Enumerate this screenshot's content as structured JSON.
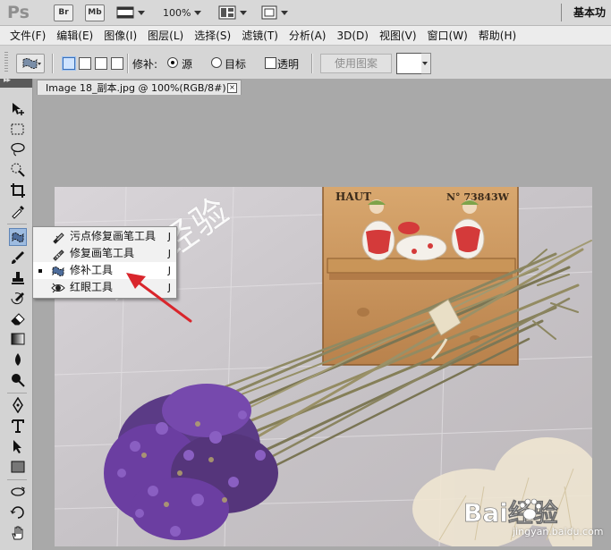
{
  "appbar": {
    "logo": "Ps",
    "bridge_label": "Br",
    "minibridge_label": "Mb",
    "zoom": "100%",
    "workspace": "基本功"
  },
  "menu": [
    "文件(F)",
    "编辑(E)",
    "图像(I)",
    "图层(L)",
    "选择(S)",
    "滤镜(T)",
    "分析(A)",
    "3D(D)",
    "视图(V)",
    "窗口(W)",
    "帮助(H)"
  ],
  "options": {
    "patch_label": "修补:",
    "source_label": "源",
    "target_label": "目标",
    "transparent_label": "透明",
    "use_pattern_label": "使用图案"
  },
  "document": {
    "tab_title": "Image 18_副本.jpg @ 100%(RGB/8#)",
    "close_symbol": "×"
  },
  "flyout": [
    {
      "label": "污点修复画笔工具",
      "key": "J",
      "icon": "spot-healing-brush-icon",
      "selected": false
    },
    {
      "label": "修复画笔工具",
      "key": "J",
      "icon": "healing-brush-icon",
      "selected": false
    },
    {
      "label": "修补工具",
      "key": "J",
      "icon": "patch-tool-icon",
      "selected": true
    },
    {
      "label": "红眼工具",
      "key": "J",
      "icon": "red-eye-icon",
      "selected": false
    }
  ],
  "photo": {
    "plaque_brand": "HAUT",
    "plaque_number": "N° 73843W"
  },
  "watermark": {
    "text": "百度经验",
    "logo_text": "Bai经验",
    "url": "jingyan.baidu.com"
  },
  "colors": {
    "selection_blue": "#9dbbe0",
    "arrow_red": "#d9262c",
    "flower_purple": "#6b3ea1"
  }
}
